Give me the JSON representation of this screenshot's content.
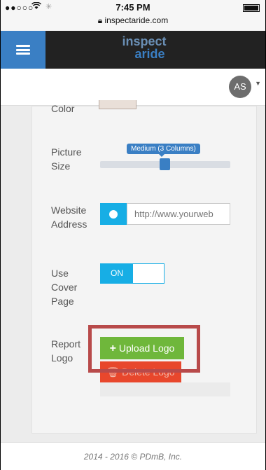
{
  "status_bar": {
    "carrier": "●●○○○",
    "wifi_icon": "wifi-icon",
    "time": "7:45 PM",
    "url": "inspectaride.com",
    "lock_icon": "lock-icon"
  },
  "nav": {
    "logo_line1": "inspect",
    "logo_line2": "aride"
  },
  "user": {
    "initials": "AS"
  },
  "form": {
    "color_label": "Color",
    "picture_size_label": "Picture\nSize",
    "picture_size_value": "Medium (3 Columns)",
    "picture_size_level": 0.5,
    "website_label": "Website\nAddress",
    "website_placeholder": "http://www.yourweb",
    "cover_label": "Use\nCover\nPage",
    "cover_toggle": "ON",
    "logo_label": "Report\nLogo",
    "upload_label": "Upload Logo",
    "delete_label": "Delete Logo"
  },
  "footer": {
    "text": "2014 - 2016 © PDmB, Inc."
  },
  "colors": {
    "brand_blue": "#3a7fc4",
    "cyan": "#17aee5",
    "green": "#6fb73b",
    "red": "#e8472c",
    "highlight": "#b84a4a"
  }
}
